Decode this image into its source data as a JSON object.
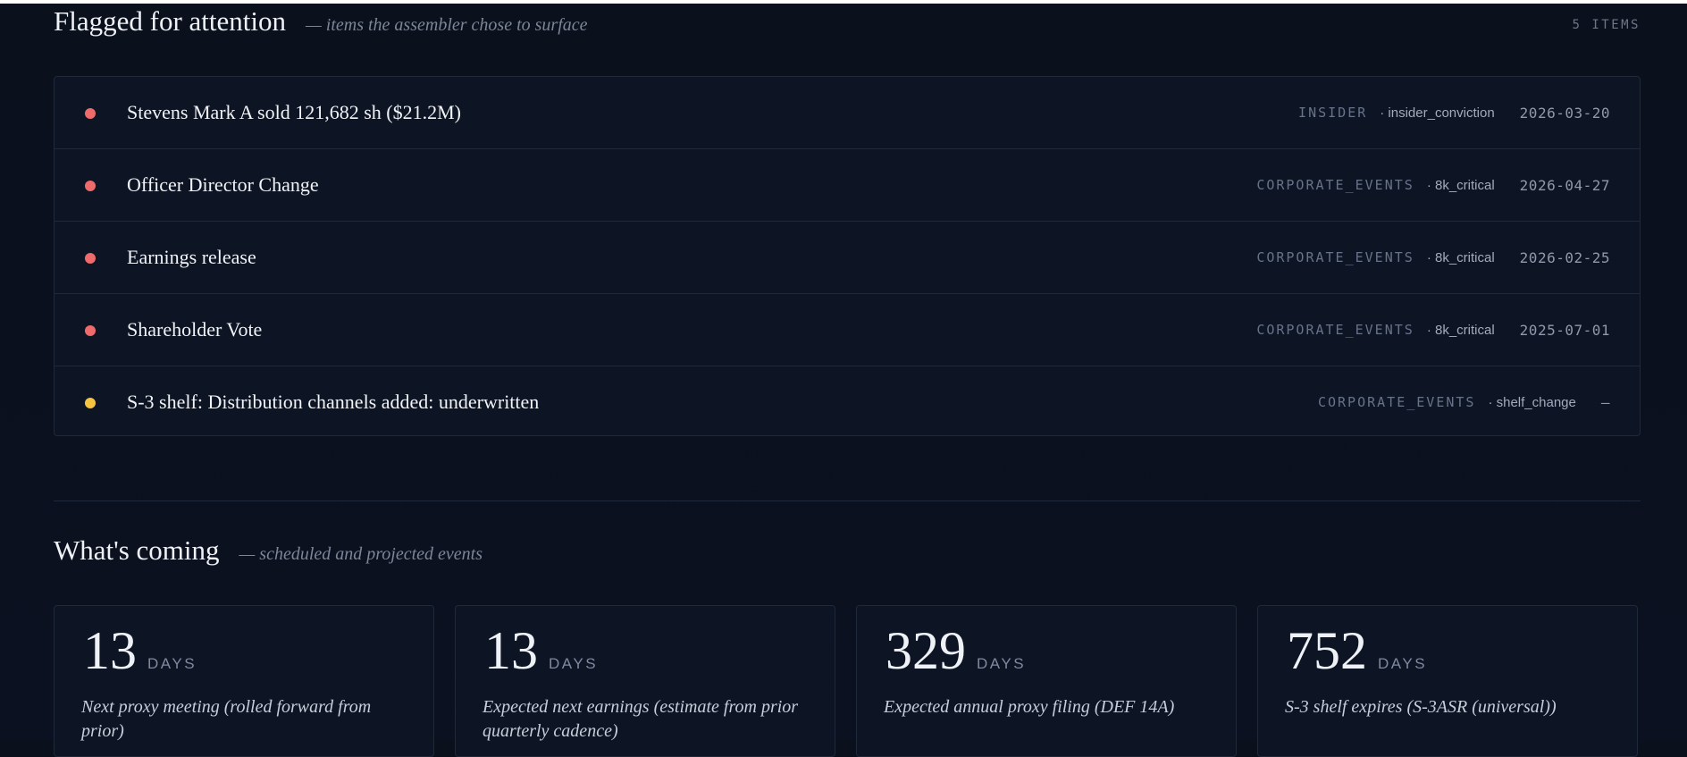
{
  "flagged": {
    "title": "Flagged for attention",
    "subtitle": "— items the assembler chose to surface",
    "count": "5 ITEMS",
    "items": [
      {
        "dot": "red",
        "title": "Stevens Mark A sold 121,682 sh ($21.2M)",
        "category": "INSIDER",
        "tag": "· insider_conviction",
        "date": "2026-03-20"
      },
      {
        "dot": "red",
        "title": "Officer Director Change",
        "category": "CORPORATE_EVENTS",
        "tag": "· 8k_critical",
        "date": "2026-04-27"
      },
      {
        "dot": "red",
        "title": "Earnings release",
        "category": "CORPORATE_EVENTS",
        "tag": "· 8k_critical",
        "date": "2026-02-25"
      },
      {
        "dot": "red",
        "title": "Shareholder Vote",
        "category": "CORPORATE_EVENTS",
        "tag": "· 8k_critical",
        "date": "2025-07-01"
      },
      {
        "dot": "yellow",
        "title": "S-3 shelf: Distribution channels added: underwritten",
        "category": "CORPORATE_EVENTS",
        "tag": "· shelf_change",
        "date": "—"
      }
    ]
  },
  "coming": {
    "title": "What's coming",
    "subtitle": "— scheduled and projected events",
    "cards": [
      {
        "number": "13",
        "unit": "DAYS",
        "description": "Next proxy meeting (rolled forward from prior)"
      },
      {
        "number": "13",
        "unit": "DAYS",
        "description": "Expected next earnings (estimate from prior quarterly cadence)"
      },
      {
        "number": "329",
        "unit": "DAYS",
        "description": "Expected annual proxy filing (DEF 14A)"
      },
      {
        "number": "752",
        "unit": "DAYS",
        "description": "S-3 shelf expires (S-3ASR (universal))"
      }
    ]
  },
  "colors": {
    "red": "#ef6b6b",
    "yellow": "#f5c542",
    "background": "#0a101c"
  }
}
